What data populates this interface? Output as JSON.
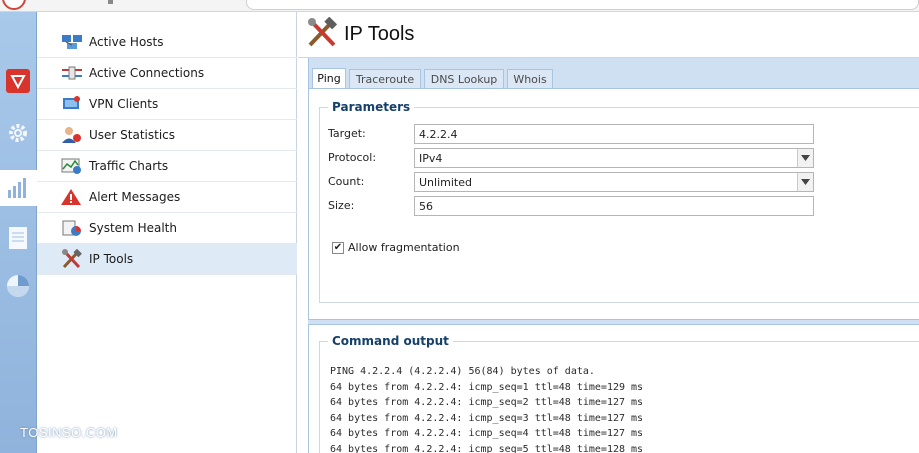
{
  "colors": {
    "rail": "#9fbfe3",
    "selected_nav": "#dfeaf7",
    "legend": "#15406b",
    "tab_bar": "#cfe0f3"
  },
  "rail": {
    "icons": [
      "shield-icon",
      "gear-icon",
      "bar-chart-icon",
      "document-icon",
      "pie-chart-icon"
    ]
  },
  "nav": {
    "items": [
      {
        "label": "Active Hosts",
        "icon": "network-hosts-icon"
      },
      {
        "label": "Active Connections",
        "icon": "connections-icon"
      },
      {
        "label": "VPN Clients",
        "icon": "vpn-clients-icon"
      },
      {
        "label": "User Statistics",
        "icon": "user-statistics-icon"
      },
      {
        "label": "Traffic Charts",
        "icon": "traffic-charts-icon"
      },
      {
        "label": "Alert Messages",
        "icon": "alert-icon"
      },
      {
        "label": "System Health",
        "icon": "system-health-icon"
      },
      {
        "label": "IP Tools",
        "icon": "tools-icon"
      }
    ],
    "selected": "IP Tools"
  },
  "page": {
    "title": "IP Tools"
  },
  "tabs": [
    "Ping",
    "Traceroute",
    "DNS Lookup",
    "Whois"
  ],
  "active_tab": "Ping",
  "parameters": {
    "legend": "Parameters",
    "target_label": "Target:",
    "target_value": "4.2.2.4",
    "protocol_label": "Protocol:",
    "protocol_value": "IPv4",
    "count_label": "Count:",
    "count_value": "Unlimited",
    "size_label": "Size:",
    "size_value": "56",
    "allow_frag_label": "Allow fragmentation",
    "allow_frag_checked": true
  },
  "output": {
    "legend": "Command output",
    "lines": [
      "PING 4.2.2.4 (4.2.2.4) 56(84) bytes of data.",
      "64 bytes from 4.2.2.4: icmp_seq=1 ttl=48 time=129 ms",
      "64 bytes from 4.2.2.4: icmp_seq=2 ttl=48 time=127 ms",
      "64 bytes from 4.2.2.4: icmp_seq=3 ttl=48 time=127 ms",
      "64 bytes from 4.2.2.4: icmp_seq=4 ttl=48 time=127 ms",
      "64 bytes from 4.2.2.4: icmp_seq=5 ttl=48 time=128 ms"
    ]
  },
  "watermark": "TOSINSO.COM"
}
